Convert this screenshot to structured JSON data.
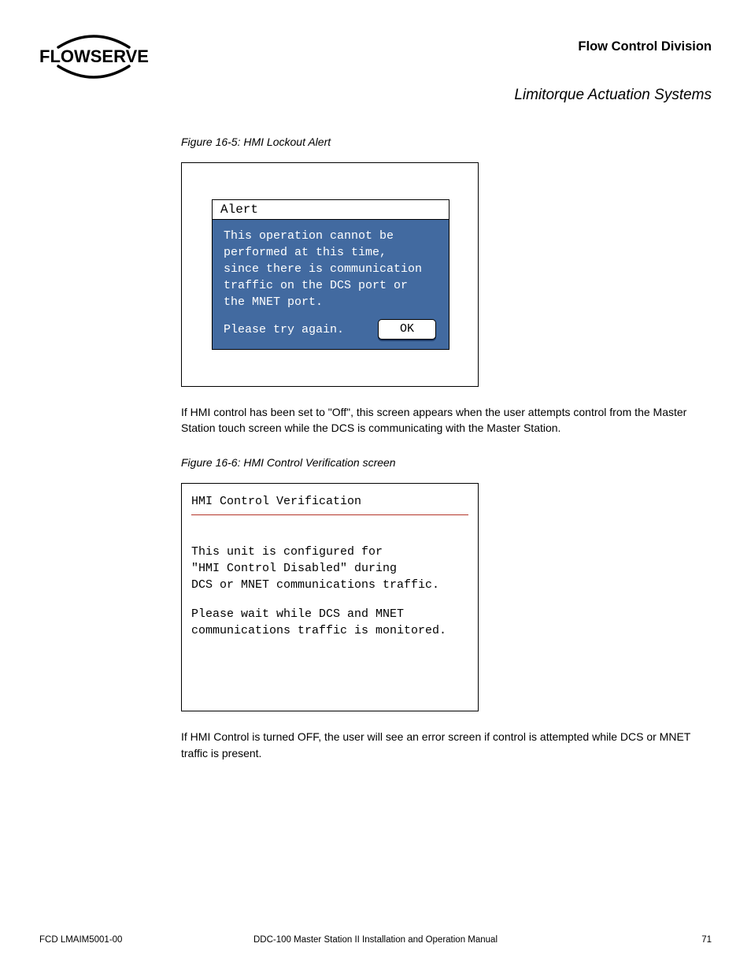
{
  "header": {
    "logo_text": "FLOWSERVE",
    "division": "Flow Control Division",
    "subtitle": "Limitorque Actuation Systems"
  },
  "figure1": {
    "caption": "Figure 16-5: HMI Lockout Alert",
    "alert_title": "Alert",
    "alert_body_line1": "This operation cannot be",
    "alert_body_line2": "performed at this time,",
    "alert_body_line3": "since there is communication",
    "alert_body_line4": "traffic on the DCS port or",
    "alert_body_line5": "the MNET port.",
    "alert_body_line6": "Please try again.",
    "ok_label": "OK"
  },
  "para1": "If HMI control has been set to \"Off\", this screen appears when the user attempts control from the Master Station touch screen while the DCS is communicating with the Master Station.",
  "figure2": {
    "caption": "Figure 16-6: HMI Control Verification screen",
    "title": "HMI Control Verification",
    "body_p1": "This unit is configured for\n\"HMI Control Disabled\" during\nDCS or MNET communications traffic.",
    "body_p2": "Please wait while DCS and MNET\ncommunications traffic is monitored."
  },
  "para2": "If HMI Control is turned OFF, the user will see an error screen if control is attempted while DCS or MNET traffic is present.",
  "footer": {
    "left": "FCD LMAIM5001-00",
    "center": "DDC-100 Master Station II Installation and Operation Manual",
    "page": "71"
  }
}
